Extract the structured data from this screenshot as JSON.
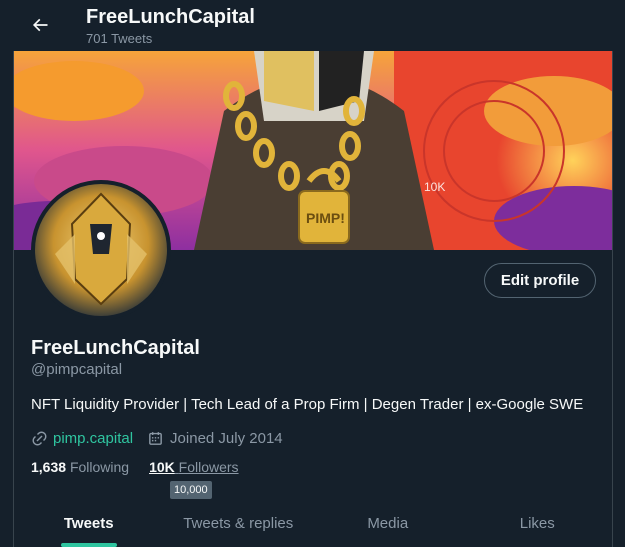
{
  "header": {
    "title": "FreeLunchCapital",
    "subtitle": "701 Tweets",
    "back_icon": "arrow-left-icon"
  },
  "profile": {
    "display_name": "FreeLunchCapital",
    "handle": "@pimpcapital",
    "bio": "NFT Liquidity Provider | Tech Lead of a Prop Firm | Degen Trader | ex-Google SWE",
    "website": "pimp.capital",
    "joined": "Joined July 2014",
    "edit_label": "Edit profile"
  },
  "stats": {
    "following_count": "1,638",
    "following_label": "Following",
    "followers_count": "10K",
    "followers_label": "Followers",
    "followers_tooltip": "10,000"
  },
  "tabs": [
    {
      "label": "Tweets",
      "active": true
    },
    {
      "label": "Tweets & replies",
      "active": false
    },
    {
      "label": "Media",
      "active": false
    },
    {
      "label": "Likes",
      "active": false
    }
  ],
  "colors": {
    "background": "#15202b",
    "accent": "#2fc5a0",
    "secondary_text": "#8b98a5"
  }
}
